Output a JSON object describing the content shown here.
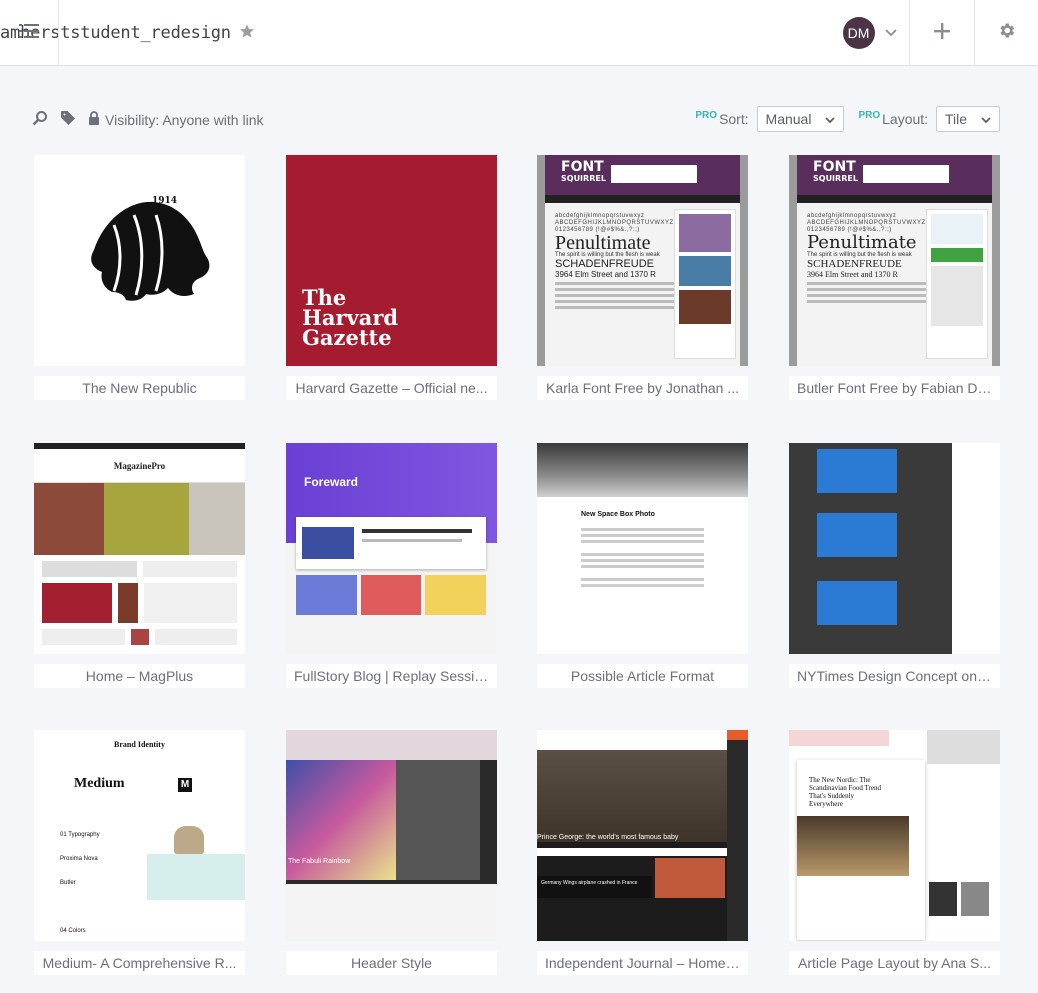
{
  "header": {
    "board_name": "amherststudent_redesign",
    "avatar_initials": "DM"
  },
  "toolbar": {
    "visibility_label": "Visibility: Anyone with link",
    "pro_badge": "PRO",
    "sort_label": "Sort:",
    "sort_value": "Manual",
    "layout_label": "Layout:",
    "layout_value": "Tile"
  },
  "cards": [
    {
      "caption": "The New Republic"
    },
    {
      "caption": "Harvard Gazette – Official ne...",
      "thumb_text": [
        "The",
        "Harvard",
        "Gazette"
      ]
    },
    {
      "caption": "Karla Font Free by Jonathan ...",
      "thumb_text": [
        "FONT",
        "SQUIRREL",
        "Penultimate",
        "SCHADENFREUDE",
        "3964 Elm Street and 1370 R"
      ]
    },
    {
      "caption": "Butler Font Free by Fabian De...",
      "thumb_text": [
        "FONT",
        "SQUIRREL",
        "Penultimate",
        "SCHADENFREUDE",
        "3964 Elm Street and 1370 R"
      ]
    },
    {
      "caption": "Home – MagPlus",
      "thumb_text": [
        "MagazinePro"
      ]
    },
    {
      "caption": "FullStory Blog | Replay Sessio...",
      "thumb_text": [
        "Foreward"
      ]
    },
    {
      "caption": "Possible Article Format",
      "thumb_text": [
        "New Space Box Photo"
      ]
    },
    {
      "caption": "NYTimes Design Concept on ..."
    },
    {
      "caption": "Medium- A Comprehensive R...",
      "thumb_text": [
        "Brand Identity",
        "Medium",
        "M",
        "01 Typography",
        "Proxima Nova",
        "Butler",
        "04 Colors"
      ]
    },
    {
      "caption": "Header Style",
      "thumb_text": [
        "The Fabuli Rainbow"
      ]
    },
    {
      "caption": "Independent Journal – Home ...",
      "thumb_text": [
        "Prince George: the world's most famous baby",
        "Germany Wings airplane crashed in France"
      ]
    },
    {
      "caption": "Article Page Layout by Ana S...",
      "thumb_text": [
        "The New Nordic: The Scandinavian Food Trend That's Suddenly Everywhere"
      ]
    }
  ]
}
